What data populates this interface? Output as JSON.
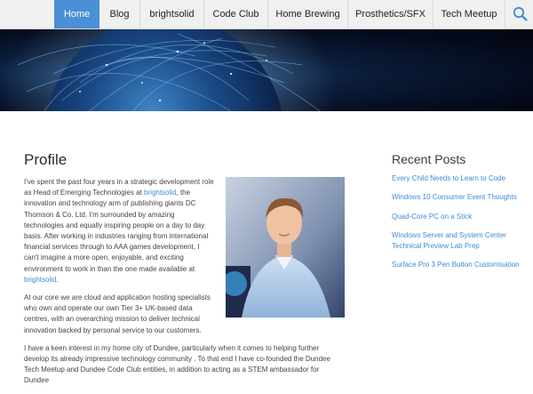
{
  "nav": {
    "items": [
      {
        "label": "Home",
        "active": true
      },
      {
        "label": "Blog"
      },
      {
        "label": "brightsolid"
      },
      {
        "label": "Code Club"
      },
      {
        "label": "Home Brewing"
      },
      {
        "label": "Prosthetics/SFX"
      },
      {
        "label": "Tech Meetup"
      }
    ],
    "search_icon": "search-icon"
  },
  "hero": {
    "image": "globe-network-banner"
  },
  "main": {
    "title": "Profile",
    "bio": {
      "p1_a": "I've spent the past four years in a strategic development role as Head of Emerging Technologies at ",
      "p1_link": "brightsolid",
      "p1_b": ", the innovation and technology arm of publishing giants DC Thomson & Co. Ltd. I'm surrounded by amazing technologies and equally inspiring people on a day to day basis. After working in industries ranging from international financial services through to AAA games development, I can't imagine a more open, enjoyable, and exciting environment to work in than the one made available at ",
      "p1_link2": "brightsolid",
      "p1_c": ".",
      "p2": "At our core we are cloud and application hosting specialists who own and operate our own Tier 3+ UK-based data centres, with an overarching mission to deliver technical innovation backed by personal service to our customers.",
      "p3": "I have a keen interest in my home city of Dundee, particularly when it comes to helping further develop its already impressive technology community . To that end I have co-founded the Dundee Tech Meetup and Dundee Code Club entities, in addition to acting as a STEM ambassador for Dundee"
    },
    "portrait": "profile-portrait-photo"
  },
  "sidebar": {
    "title": "Recent Posts",
    "posts": [
      "Every Child Needs to Learn to Code",
      "Windows 10 Consumer Event Thoughts",
      "Quad-Core PC on a Stick",
      "Windows Server and System Center Technical Preview Lab Prep",
      "Surface Pro 3 Pen Button Customisation"
    ]
  },
  "colors": {
    "accent": "#4b8fd6",
    "link": "#3d8bd6",
    "nav_bg": "#f0f0f0"
  }
}
